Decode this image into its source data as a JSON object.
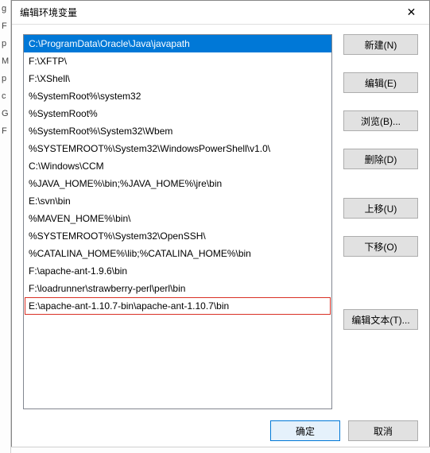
{
  "left_strip_chars": [
    "g",
    "",
    "",
    "",
    "F",
    "p",
    "M",
    "p",
    "",
    "",
    "",
    "",
    "c",
    "",
    "",
    "",
    "",
    "",
    "",
    "G",
    "F"
  ],
  "window": {
    "title": "编辑环境变量",
    "close_glyph": "✕"
  },
  "list": {
    "items": [
      {
        "text": "C:\\ProgramData\\Oracle\\Java\\javapath",
        "selected": true
      },
      {
        "text": "F:\\XFTP\\"
      },
      {
        "text": "F:\\XShell\\"
      },
      {
        "text": "%SystemRoot%\\system32"
      },
      {
        "text": "%SystemRoot%"
      },
      {
        "text": "%SystemRoot%\\System32\\Wbem"
      },
      {
        "text": "%SYSTEMROOT%\\System32\\WindowsPowerShell\\v1.0\\"
      },
      {
        "text": "C:\\Windows\\CCM"
      },
      {
        "text": "%JAVA_HOME%\\bin;%JAVA_HOME%\\jre\\bin"
      },
      {
        "text": "E:\\svn\\bin"
      },
      {
        "text": "%MAVEN_HOME%\\bin\\"
      },
      {
        "text": "%SYSTEMROOT%\\System32\\OpenSSH\\"
      },
      {
        "text": "%CATALINA_HOME%\\lib;%CATALINA_HOME%\\bin"
      },
      {
        "text": "F:\\apache-ant-1.9.6\\bin"
      },
      {
        "text": "F:\\loadrunner\\strawberry-perl\\perl\\bin"
      },
      {
        "text": "E:\\apache-ant-1.10.7-bin\\apache-ant-1.10.7\\bin"
      }
    ],
    "highlight_index": 15
  },
  "buttons": {
    "new": "新建(N)",
    "edit": "编辑(E)",
    "browse": "浏览(B)...",
    "delete": "删除(D)",
    "move_up": "上移(U)",
    "move_down": "下移(O)",
    "edit_text": "编辑文本(T)..."
  },
  "footer": {
    "ok": "确定",
    "cancel": "取消"
  }
}
